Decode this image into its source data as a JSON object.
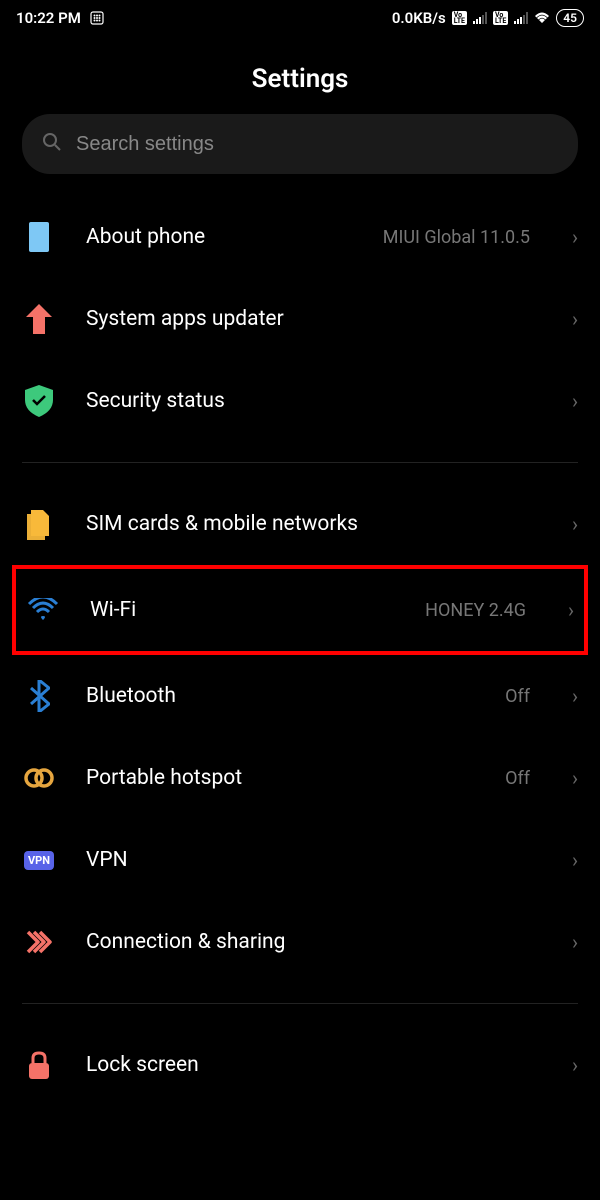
{
  "status": {
    "time": "10:22 PM",
    "data_rate": "0.0KB/s",
    "battery": "45"
  },
  "page": {
    "title": "Settings"
  },
  "search": {
    "placeholder": "Search settings"
  },
  "items": {
    "about": {
      "label": "About phone",
      "value": "MIUI Global 11.0.5"
    },
    "updater": {
      "label": "System apps updater"
    },
    "security": {
      "label": "Security status"
    },
    "sim": {
      "label": "SIM cards & mobile networks"
    },
    "wifi": {
      "label": "Wi-Fi",
      "value": "HONEY 2.4G"
    },
    "bluetooth": {
      "label": "Bluetooth",
      "value": "Off"
    },
    "hotspot": {
      "label": "Portable hotspot",
      "value": "Off"
    },
    "vpn": {
      "label": "VPN",
      "badge": "VPN"
    },
    "connection": {
      "label": "Connection & sharing"
    },
    "lockscreen": {
      "label": "Lock screen"
    }
  }
}
